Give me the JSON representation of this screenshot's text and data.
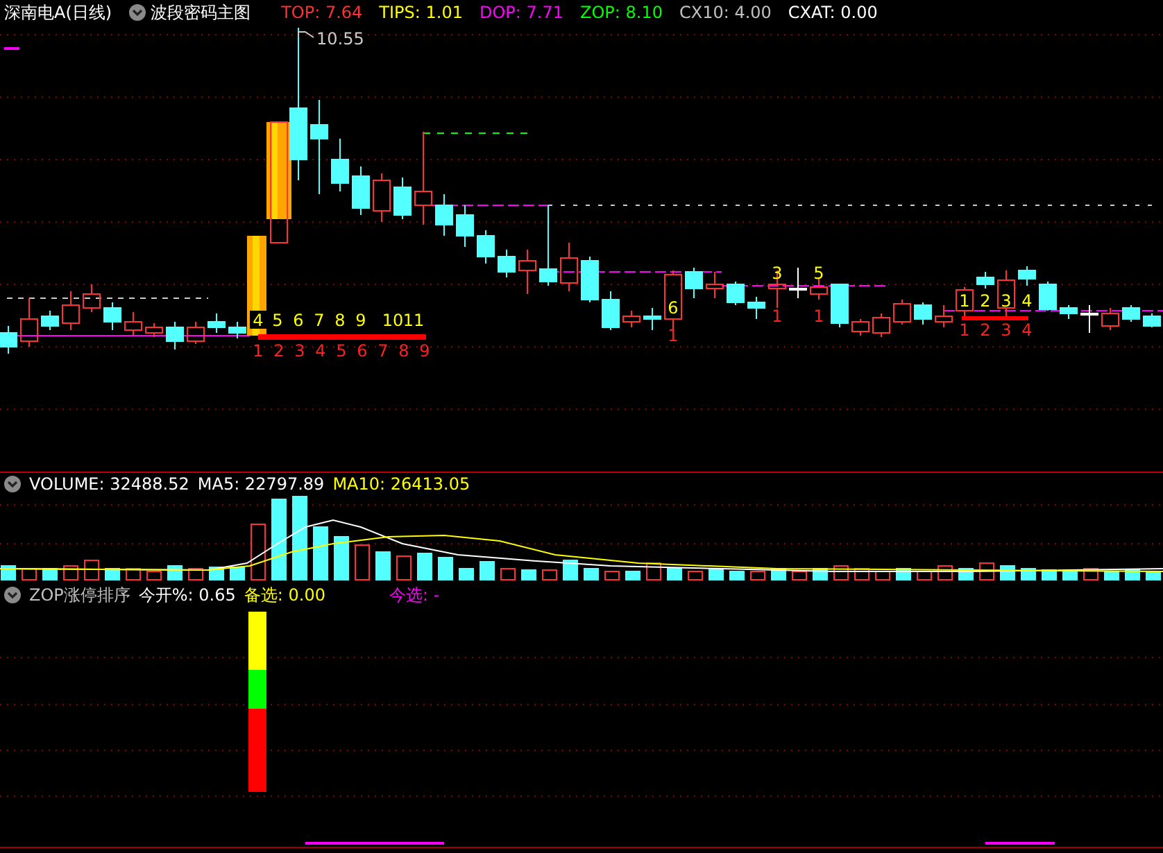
{
  "header": {
    "title": "深南电A(日线)",
    "indicator": "波段密码主图",
    "readouts": [
      {
        "label": "TOP: 7.64",
        "color": "#ff3030"
      },
      {
        "label": "TIPS: 1.01",
        "color": "#ffff00"
      },
      {
        "label": "DOP: 7.71",
        "color": "#ff00ff"
      },
      {
        "label": "ZOP: 8.10",
        "color": "#00ff00"
      },
      {
        "label": "CX10: 4.00",
        "color": "#c0c0c0"
      },
      {
        "label": "CXAT: 0.00",
        "color": "#ffffff"
      }
    ]
  },
  "main_chart": {
    "high_label": "10.55",
    "signals": [
      {
        "upper": [
          "4",
          "5",
          "6",
          "7",
          "8",
          "9",
          "10",
          "11"
        ],
        "lower": [
          "1",
          "2",
          "3",
          "4",
          "5",
          "6",
          "7",
          "8",
          "9"
        ]
      },
      {
        "upper": [
          "6"
        ],
        "lower": [
          "1"
        ]
      },
      {
        "upper": [
          "3"
        ],
        "lower": [
          "1"
        ]
      },
      {
        "upper": [
          "5"
        ],
        "lower": [
          "1"
        ]
      },
      {
        "upper": [
          "1",
          "2",
          "3",
          "4"
        ],
        "lower": [
          "1",
          "2",
          "3",
          "4"
        ]
      }
    ]
  },
  "volume_panel": {
    "readouts": [
      {
        "label": "VOLUME: 32488.52",
        "color": "#ffffff"
      },
      {
        "label": "MA5: 22797.89",
        "color": "#ffffff"
      },
      {
        "label": "MA10: 26413.05",
        "color": "#ffff00"
      }
    ]
  },
  "zop_panel": {
    "readouts": [
      {
        "label": "ZOP涨停排序",
        "color": "#c0c0c0"
      },
      {
        "label": "今开%: 0.65",
        "color": "#ffffff"
      },
      {
        "label": "备选: 0.00",
        "color": "#ffff00"
      },
      {
        "label": "今选: -",
        "color": "#ff00ff"
      }
    ]
  }
}
